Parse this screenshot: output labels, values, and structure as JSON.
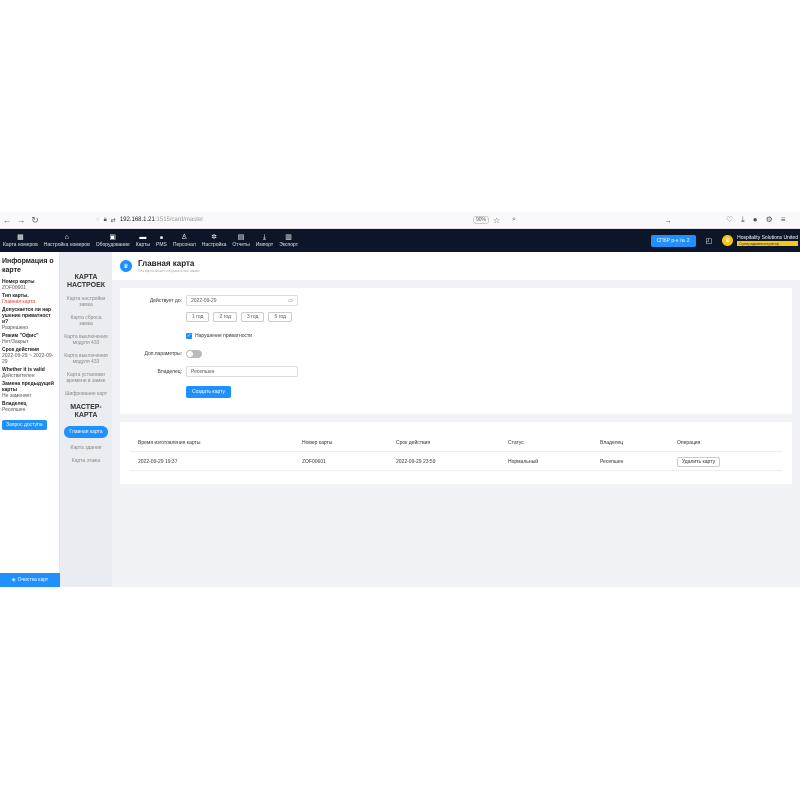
{
  "browser": {
    "url_host": "192.168.1.21",
    "url_rest": ":1515/card/master",
    "zoom": "90%"
  },
  "topnav": {
    "items": [
      {
        "label": "Карта номеров",
        "icon": "building-icon"
      },
      {
        "label": "Настройка номеров",
        "icon": "home-icon"
      },
      {
        "label": "Оборудование",
        "icon": "device-icon"
      },
      {
        "label": "Карты",
        "icon": "card-icon"
      },
      {
        "label": "PMS",
        "icon": "pms-icon"
      },
      {
        "label": "Персонал",
        "icon": "person-icon"
      },
      {
        "label": "Настройка",
        "icon": "gear-icon"
      },
      {
        "label": "Отчеты",
        "icon": "report-icon"
      },
      {
        "label": "Импорт",
        "icon": "import-icon"
      },
      {
        "label": "Экспорт",
        "icon": "export-icon"
      }
    ],
    "hotel_button": "СПбР р-н № 2",
    "org_name": "Hospitality Solutions United",
    "org_badge": "Суперадминистратор"
  },
  "left_panel": {
    "title": "Информация о карте",
    "fields": [
      {
        "label": "Номер карты",
        "value": "ZOF00601",
        "value_color": "normal"
      },
      {
        "label": "Тип карты.",
        "value": "Главная карта",
        "value_color": "red"
      },
      {
        "label": "Допускается ли нар ушение приватност и?",
        "value": "Разрешено",
        "value_color": "normal"
      },
      {
        "label": "Режим \"Офис\"",
        "value": "Нет/Закрыт",
        "value_color": "normal"
      },
      {
        "label": "Срок действия",
        "value": "2022-09-29 ~ 2022-09-29",
        "value_color": "normal"
      },
      {
        "label": "Whether it is valid",
        "value": "Действителен",
        "value_color": "normal"
      },
      {
        "label": "Замена предыдущей карты",
        "value": "Не заменяет",
        "value_color": "normal"
      },
      {
        "label": "Владелец",
        "value": "Ресепшен",
        "value_color": "normal"
      }
    ],
    "access_button": "Запрос доступа",
    "clear_button": "Очистка карт"
  },
  "sidebar2": {
    "section1": "КАРТА НАСТРОЕК",
    "section1_items": [
      "Карта настройки замка",
      "Карта сброса замка",
      "Карта выключения модуля 433",
      "Карта выключения модуля 433",
      "Карта установки времени в замке",
      "Шифрование карт"
    ],
    "section2": "МАСТЕР-КАРТА",
    "section2_items": [
      {
        "label": "Главная карта",
        "active": true
      },
      {
        "label": "Карта здания",
        "active": false
      },
      {
        "label": "Карта этажа",
        "active": false
      }
    ]
  },
  "page": {
    "title": "Главная карта",
    "subtitle": "Эта карта может открывать все замки"
  },
  "form": {
    "valid_until_label": "Действует до:",
    "valid_until_value": "2022-09-29",
    "year_buttons": [
      "1 год",
      "2 год",
      "3 год",
      "5 год"
    ],
    "privacy_label": "Нарушение приватности",
    "privacy_checked": true,
    "extra_params_label": "Доп.параметры:",
    "extra_params_on": false,
    "owner_label": "Владелец:",
    "owner_value": "Ресепшен",
    "create_button": "Создать карту"
  },
  "table": {
    "columns": [
      "Время изготовления карты",
      "Номер карты",
      "Срок действия",
      "Статус",
      "Владелец",
      "Операция"
    ],
    "rows": [
      {
        "made_at": "2022-09-29 19:37",
        "card_no": "ZOF00601",
        "valid_until": "2022-09-29 23:59",
        "status": "Нормальный",
        "owner": "Ресепшен",
        "action": "Удалить карту"
      }
    ]
  },
  "colors": {
    "accent": "#1e90ff",
    "topbar": "#0d1529",
    "warning_red": "#e53935",
    "badge_yellow": "#f5c518"
  }
}
